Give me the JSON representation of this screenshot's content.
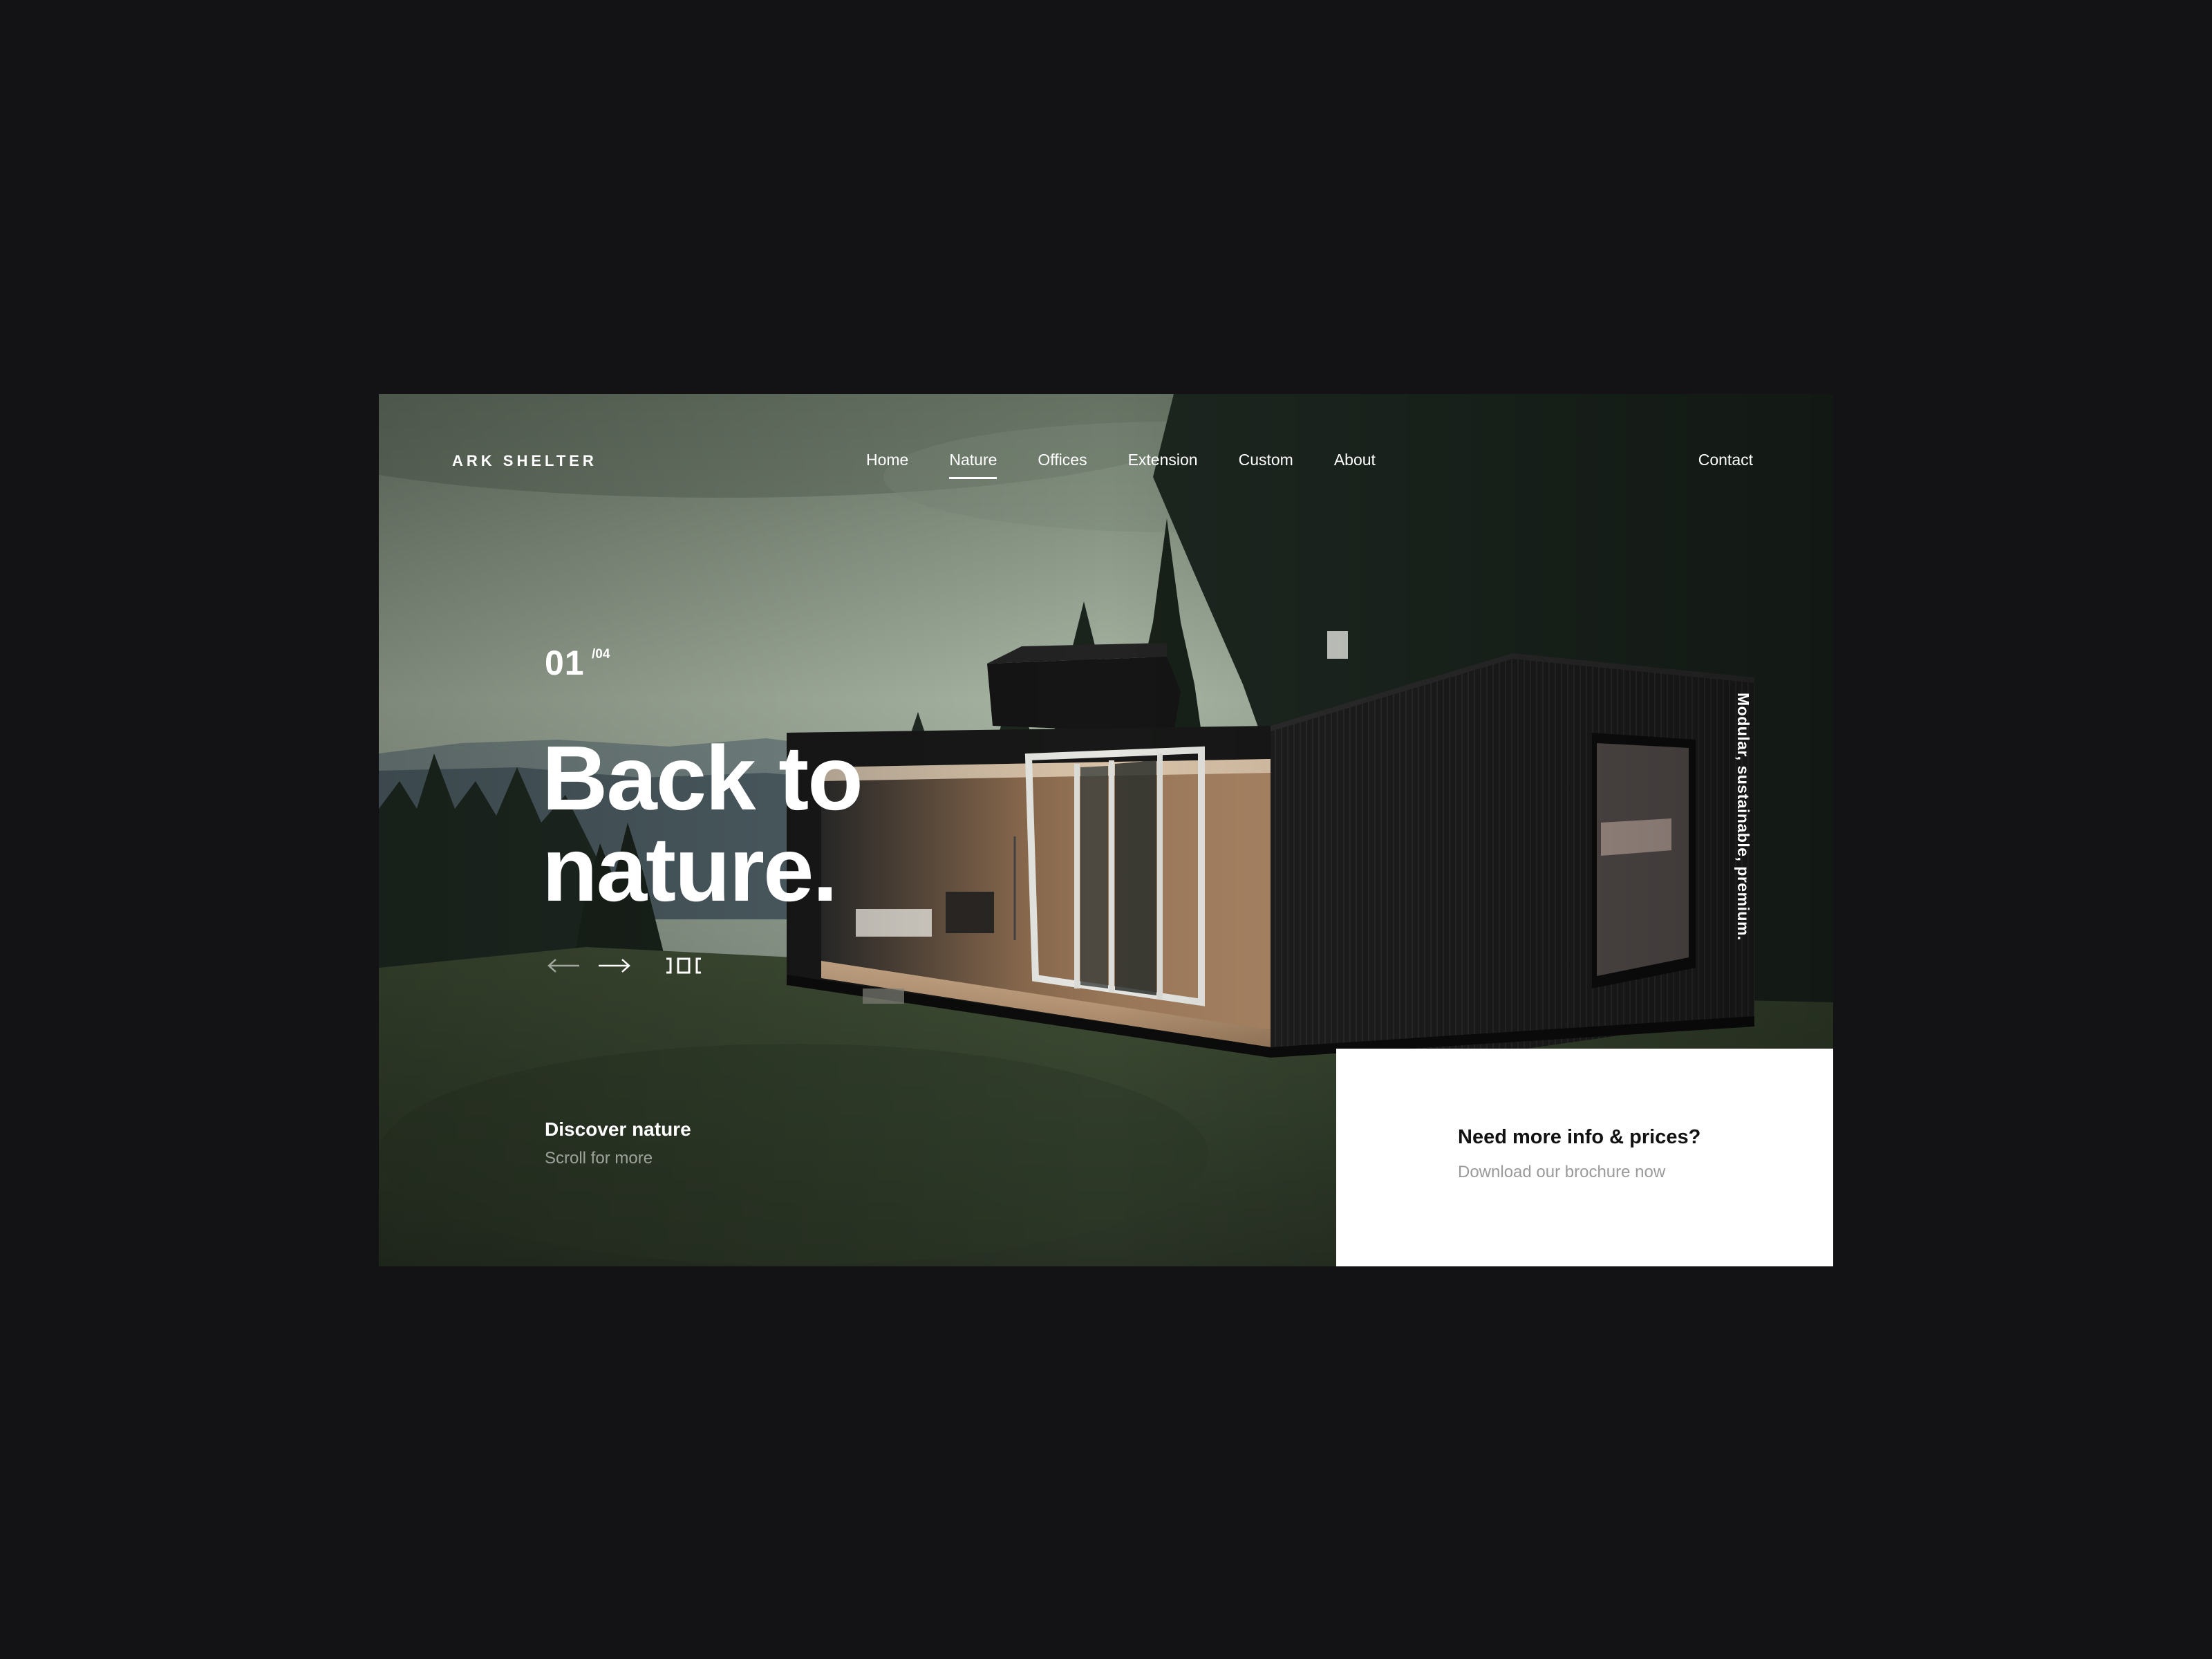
{
  "page": {
    "background_color": "#131315",
    "card_color": "#ffffff"
  },
  "header": {
    "logo": "ARK SHELTER",
    "nav": [
      {
        "label": "Home",
        "active": false
      },
      {
        "label": "Nature",
        "active": true
      },
      {
        "label": "Offices",
        "active": false
      },
      {
        "label": "Extension",
        "active": false
      },
      {
        "label": "Custom",
        "active": false
      },
      {
        "label": "About",
        "active": false
      }
    ],
    "contact": "Contact"
  },
  "hero": {
    "slide_current": "01",
    "slide_total": "/04",
    "headline_line1": "Back to",
    "headline_line2": "nature.",
    "controls": {
      "prev_icon": "arrow-left-icon",
      "next_icon": "arrow-right-icon",
      "grid_icon": "grid-view-icon"
    },
    "vertical_tagline": "Modular, sustainable, premium.",
    "discover_title": "Discover nature",
    "discover_subtitle": "Scroll for more"
  },
  "brochure": {
    "title": "Need more info & prices?",
    "subtitle": "Download our brochure now"
  }
}
